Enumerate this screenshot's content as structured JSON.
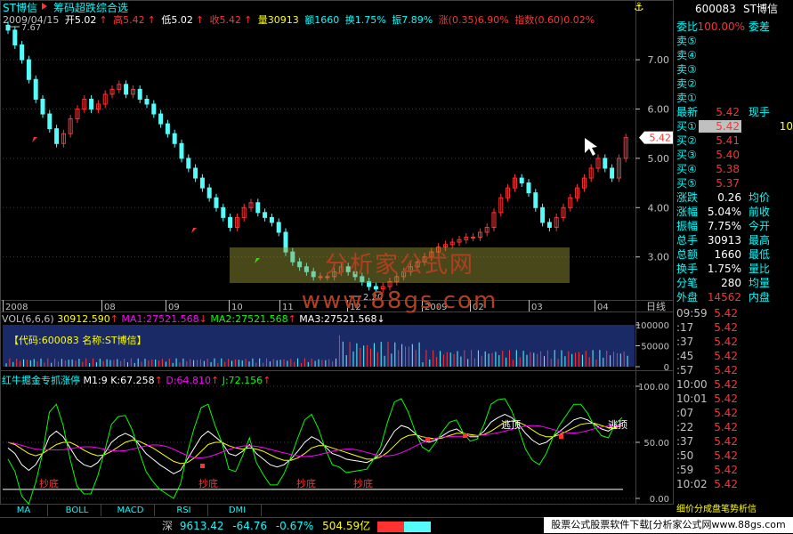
{
  "stock_title": "ST博信",
  "formula_label": "筹码超跌综合选",
  "header": {
    "date": "2009/04/15",
    "open": "开5.02",
    "high": "高5.42",
    "low": "低5.02",
    "close": "收5.42",
    "volume": "量30913",
    "amount": "额1660",
    "turnover": "换1.75%",
    "amplitude": "振7.89%",
    "change": "涨(0.35)6.90%",
    "index": "指数(0.60)0.02%"
  },
  "price_axis": [
    "7.00",
    "6.00",
    "5.00",
    "4.00",
    "3.00"
  ],
  "price_max_label": "7.67",
  "price_min_label": "2.20",
  "current_price_tag": "5.42",
  "date_axis": [
    "2008",
    "08",
    "09",
    "10",
    "11",
    "12",
    "2009",
    "02",
    "03",
    "04"
  ],
  "date_axis_mode": "日线",
  "volume_label": {
    "title": "VOL(6,6,6)",
    "vol": "30912.590",
    "ma1": "MA1:27521.568",
    "ma2": "MA2:27521.568",
    "ma3": "MA3:27521.568"
  },
  "volume_axis": [
    "100000",
    "50000",
    "0"
  ],
  "volume_info": "【代码:600083 名称:ST博信】",
  "indicator_label": {
    "title": "红牛掘金专抓涨停",
    "m1": "M1:9",
    "k": "K:67.258",
    "d": "D:64.810",
    "j": "J:72.156"
  },
  "indicator_axis": [
    "100.00",
    "50.00",
    "0.00"
  ],
  "indicator_annotations": [
    "抄底",
    "抄底",
    "抄底",
    "抄底",
    "逃顶",
    "逃顶"
  ],
  "tabs": [
    "MA",
    "BOLL",
    "MACD",
    "RSI",
    "DMI"
  ],
  "quote": {
    "code": "600083",
    "name": "ST博信",
    "weibi_label": "委比",
    "weibi": "100.00%",
    "weicha_label": "委差",
    "sell": [
      "卖⑤",
      "卖④",
      "卖③",
      "卖②",
      "卖①"
    ],
    "latest_label": "最新",
    "latest": "5.42",
    "hand_label": "现手",
    "buy": [
      {
        "label": "买①",
        "price": "5.42",
        "qty": "10"
      },
      {
        "label": "买②",
        "price": "5.41",
        "qty": ""
      },
      {
        "label": "买③",
        "price": "5.40",
        "qty": ""
      },
      {
        "label": "买④",
        "price": "5.38",
        "qty": ""
      },
      {
        "label": "买⑤",
        "price": "5.37",
        "qty": ""
      }
    ],
    "stats": [
      {
        "l1": "涨跌",
        "v1": "0.26",
        "l2": "均价"
      },
      {
        "l1": "涨幅",
        "v1": "5.04%",
        "l2": "前收"
      },
      {
        "l1": "振幅",
        "v1": "7.75%",
        "l2": "今开"
      },
      {
        "l1": "总手",
        "v1": "30913",
        "l2": "最高"
      },
      {
        "l1": "总额",
        "v1": "1660",
        "l2": "最低"
      },
      {
        "l1": "换手",
        "v1": "1.75%",
        "l2": "量比"
      },
      {
        "l1": "分笔",
        "v1": "280",
        "l2": "均量"
      }
    ],
    "outer_label": "外盘",
    "outer": "14562",
    "inner_label": "内盘"
  },
  "ticks": [
    {
      "t": "09:59",
      "p": "5.42"
    },
    {
      "t": ":17",
      "p": "5.42"
    },
    {
      "t": ":37",
      "p": "5.42"
    },
    {
      "t": ":45",
      "p": "5.42"
    },
    {
      "t": ":57",
      "p": "5.42"
    },
    {
      "t": "10:00",
      "p": "5.42"
    },
    {
      "t": "10:01",
      "p": "5.42"
    },
    {
      "t": ":07",
      "p": "5.42"
    },
    {
      "t": ":22",
      "p": "5.42"
    },
    {
      "t": ":37",
      "p": "5.42"
    },
    {
      "t": ":50",
      "p": "5.42"
    },
    {
      "t": ":59",
      "p": "5.42"
    },
    {
      "t": "10:02",
      "p": "5.42"
    }
  ],
  "tick_footer": "细价分成盘笔势析信",
  "status": {
    "index_name": "深",
    "index_value": "9613.42",
    "index_change": "-64.76",
    "index_pct": "-0.67%",
    "index_amount": "504.59亿"
  },
  "ad_text": "股票公式股票软件下载[分析家公式网www.88gs.com",
  "watermark": "分析家公式网www.88gs.com",
  "colors": {
    "up": "#ff3232",
    "down": "#54fcfc",
    "k": "#ffffff",
    "d": "#ffff00",
    "j": "#00ff00",
    "ma": "#ff00ff",
    "accent": "#00ffff"
  },
  "chart_data": [
    {
      "type": "candlestick",
      "title": "ST博信",
      "ylim": [
        2.2,
        7.67
      ],
      "x_ticks": [
        "2008",
        "08",
        "09",
        "10",
        "11",
        "12",
        "2009",
        "02",
        "03",
        "04"
      ],
      "values": [
        7.6,
        7.3,
        7.0,
        6.6,
        6.2,
        5.9,
        5.6,
        5.3,
        5.5,
        5.8,
        6.0,
        6.2,
        6.0,
        6.1,
        6.3,
        6.4,
        6.5,
        6.3,
        6.4,
        6.2,
        6.1,
        5.9,
        5.7,
        5.5,
        5.3,
        5.0,
        4.8,
        4.6,
        4.4,
        4.2,
        4.0,
        3.8,
        3.6,
        3.8,
        4.0,
        4.1,
        3.9,
        3.8,
        3.7,
        3.5,
        3.1,
        2.9,
        2.8,
        2.7,
        2.6,
        2.6,
        2.6,
        2.7,
        2.8,
        2.7,
        2.6,
        2.5,
        2.4,
        2.35,
        2.4,
        2.5,
        2.6,
        2.7,
        2.8,
        2.9,
        3.0,
        3.1,
        3.2,
        3.25,
        3.3,
        3.35,
        3.4,
        3.4,
        3.5,
        3.6,
        3.9,
        4.2,
        4.4,
        4.6,
        4.5,
        4.3,
        4.0,
        3.7,
        3.6,
        3.8,
        4.0,
        4.2,
        4.4,
        4.6,
        4.8,
        5.0,
        4.8,
        4.6,
        5.0,
        5.42
      ]
    },
    {
      "type": "bar",
      "title": "VOL(6,6,6)",
      "ylim": [
        0,
        100000
      ]
    },
    {
      "type": "line",
      "title": "红牛掘金专抓涨停",
      "ylim": [
        0,
        100
      ],
      "series": [
        {
          "name": "K",
          "values": [
            45,
            40,
            30,
            25,
            30,
            40,
            55,
            60,
            55,
            45,
            35,
            30,
            28,
            32,
            40,
            50,
            55,
            58,
            55,
            48,
            40,
            35,
            30,
            26,
            22,
            25,
            35,
            45,
            55,
            60,
            55,
            50,
            40,
            38,
            42,
            48,
            40,
            35,
            30,
            28,
            30,
            35,
            42,
            50,
            55,
            52,
            46,
            40,
            38,
            35,
            34,
            33,
            32,
            35,
            40,
            50,
            60,
            65,
            63,
            58,
            52,
            50,
            52,
            56,
            60,
            62,
            58,
            55,
            55,
            60,
            68,
            72,
            75,
            72,
            66,
            58,
            52,
            48,
            50,
            55,
            60,
            65,
            70,
            72,
            70,
            66,
            62,
            60,
            64,
            67.258
          ]
        },
        {
          "name": "D",
          "values": [
            50,
            48,
            44,
            40,
            38,
            40,
            44,
            48,
            50,
            50,
            47,
            43,
            40,
            38,
            39,
            42,
            46,
            50,
            52,
            51,
            48,
            45,
            41,
            37,
            33,
            31,
            32,
            36,
            42,
            48,
            50,
            50,
            47,
            45,
            44,
            45,
            44,
            42,
            39,
            36,
            34,
            34,
            36,
            40,
            45,
            47,
            47,
            45,
            43,
            41,
            39,
            37,
            35,
            35,
            37,
            41,
            47,
            53,
            56,
            57,
            55,
            54,
            53,
            54,
            56,
            58,
            58,
            57,
            56,
            57,
            60,
            64,
            68,
            69,
            68,
            65,
            61,
            57,
            55,
            55,
            57,
            60,
            63,
            66,
            67,
            67,
            65,
            63,
            63,
            64.81
          ]
        },
        {
          "name": "J",
          "values": [
            35,
            24,
            2,
            -5,
            14,
            40,
            77,
            84,
            65,
            35,
            11,
            4,
            4,
            20,
            42,
            66,
            73,
            74,
            61,
            42,
            24,
            15,
            8,
            4,
            0,
            13,
            41,
            63,
            81,
            84,
            65,
            50,
            26,
            24,
            38,
            54,
            32,
            21,
            12,
            12,
            22,
            37,
            54,
            70,
            75,
            62,
            44,
            30,
            28,
            23,
            24,
            25,
            26,
            35,
            46,
            68,
            86,
            89,
            77,
            60,
            46,
            42,
            50,
            60,
            68,
            70,
            58,
            51,
            53,
            66,
            84,
            88,
            89,
            78,
            62,
            44,
            34,
            30,
            40,
            55,
            66,
            75,
            84,
            84,
            76,
            64,
            56,
            54,
            66,
            72.156
          ]
        }
      ]
    }
  ]
}
